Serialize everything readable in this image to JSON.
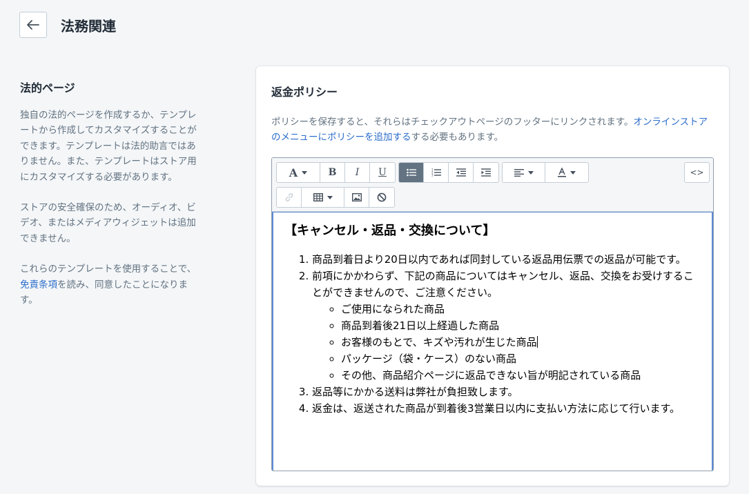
{
  "header": {
    "title": "法務関連",
    "back_icon": "arrow-left-icon"
  },
  "sidebar": {
    "title": "法的ページ",
    "p1": "独自の法的ページを作成するか、テンプレートから作成してカスタマイズすることができます。テンプレートは法的助言ではありません。また、テンプレートはストア用にカスタマイズする必要があります。",
    "p2": "ストアの安全確保のため、オーディオ、ビデオ、またはメディアウィジェットは追加できません。",
    "p3_before": "これらのテンプレートを使用することで、",
    "p3_link": "免責条項",
    "p3_after": "を読み、同意したことになります。"
  },
  "card": {
    "title": "返金ポリシー",
    "desc_before": "ポリシーを保存すると、それらはチェックアウトページのフッターにリンクされます。",
    "desc_link": "オンラインストアのメニューにポリシーを追加する",
    "desc_after": "する必要もあります。"
  },
  "toolbar": {
    "code_label": "<>"
  },
  "content": {
    "heading": "【キャンセル・返品・交換について】",
    "items": [
      "商品到着日より20日以内であれば同封している返品用伝票での返品が可能です。",
      "前項にかかわらず、下記の商品についてはキャンセル、返品、交換をお受けすることができませんので、ご注意ください。",
      "返品等にかかる送料は弊社が負担致します。",
      "返金は、返送された商品が到着後3営業日以内に支払い方法に応じて行います。"
    ],
    "subitems": [
      "ご使用になられた商品",
      "商品到着後21日以上経過した商品",
      "お客様のもとで、キズや汚れが生じた商品",
      "パッケージ（袋・ケース）のない商品",
      "その他、商品紹介ページに返品できない旨が明記されている商品"
    ]
  }
}
